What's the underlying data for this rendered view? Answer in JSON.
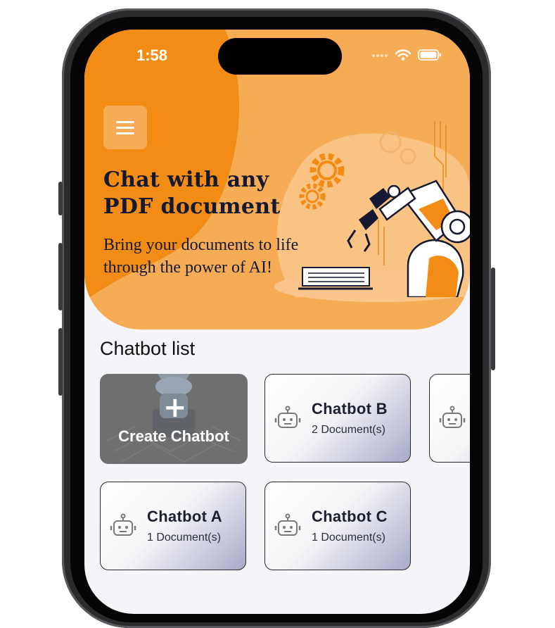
{
  "status_bar": {
    "time": "1:58"
  },
  "hero": {
    "title": "Chat with any PDF document",
    "subtitle": "Bring your documents to life through the power of AI!"
  },
  "section_title": "Chatbot list",
  "create_card": {
    "label": "Create Chatbot",
    "plus": "+"
  },
  "chatbots": [
    {
      "name": "Chatbot B",
      "docs": "2 Document(s)"
    },
    {
      "name": "Chatbot A",
      "docs": "1 Document(s)"
    },
    {
      "name": "Chatbot C",
      "docs": "1 Document(s)"
    }
  ],
  "colors": {
    "hero_bg": "#f6ac54",
    "hero_blob": "#f28c14",
    "title_text": "#141830",
    "screen_bg": "#f5f4f8"
  },
  "icons": [
    "menu-icon",
    "wifi-icon",
    "battery-icon",
    "cellular-icon",
    "robot-icon",
    "gear-icon"
  ]
}
